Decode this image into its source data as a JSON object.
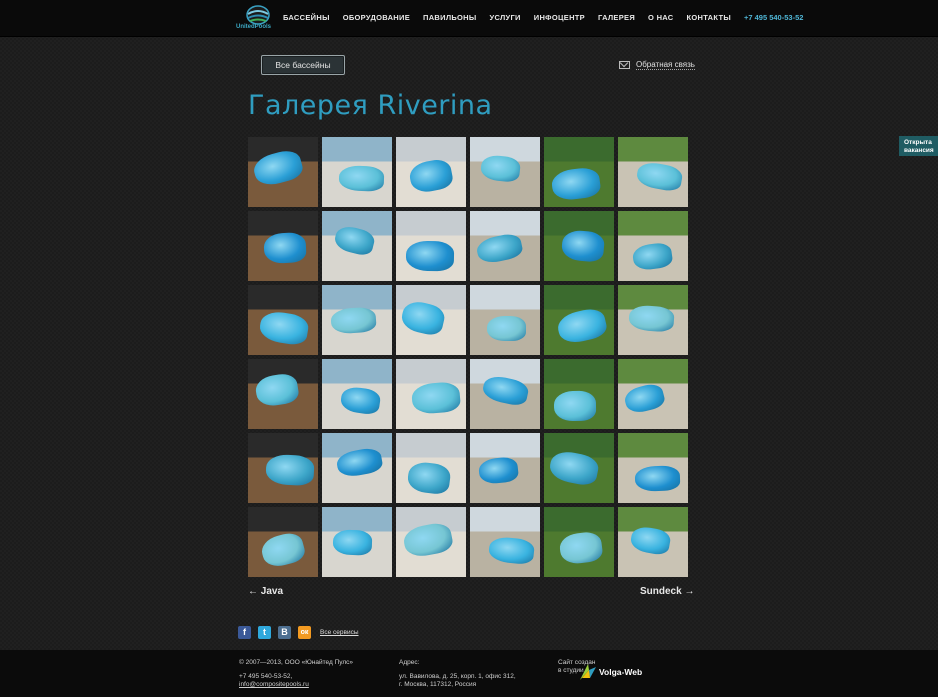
{
  "header": {
    "logo_text": "UnitedPools",
    "nav": [
      "БАССЕЙНЫ",
      "ОБОРУДОВАНИЕ",
      "ПАВИЛЬОНЫ",
      "УСЛУГИ",
      "ИНФОЦЕНТР",
      "ГАЛЕРЕЯ",
      "О НАС",
      "КОНТАКТЫ"
    ],
    "phone": "+7 495 540-53-52"
  },
  "controls": {
    "all_pools_label": "Все бассейны",
    "feedback_label": "Обратная связь"
  },
  "title": "Галерея Riverina",
  "vacancy_tab": "Открыта вакансия",
  "gallery": {
    "rows": 6,
    "cols": 6
  },
  "pagination": {
    "prev": "← Java",
    "next": "Sundeck →"
  },
  "social": {
    "icons": [
      "facebook-icon",
      "twitter-icon",
      "vkontakte-icon",
      "odnoklassniki-icon"
    ],
    "glyphs": [
      "f",
      "t",
      "В",
      "ок"
    ],
    "colors": [
      "#3b5998",
      "#2fa8dc",
      "#4d6f91",
      "#f39a21"
    ],
    "all_services": "Все сервисы"
  },
  "footer": {
    "copyright": "© 2007—2013, ООО «Юнайтед Пулс»",
    "phone": "+7 495 540-53-52,",
    "email": "info@compositepools.ru",
    "address_label": "Адрес:",
    "address_line1": "ул. Вавилова, д. 25, корп. 1, офис 312,",
    "address_line2": "г. Москва, 117312, Россия",
    "made_by_line1": "Сайт создан",
    "made_by_line2": "в студии",
    "studio": "Volga-Web"
  },
  "colors": {
    "accent": "#2f9dc0",
    "pool_blue": "#2a9fd6",
    "vacancy_bg": "#1f5c63"
  }
}
